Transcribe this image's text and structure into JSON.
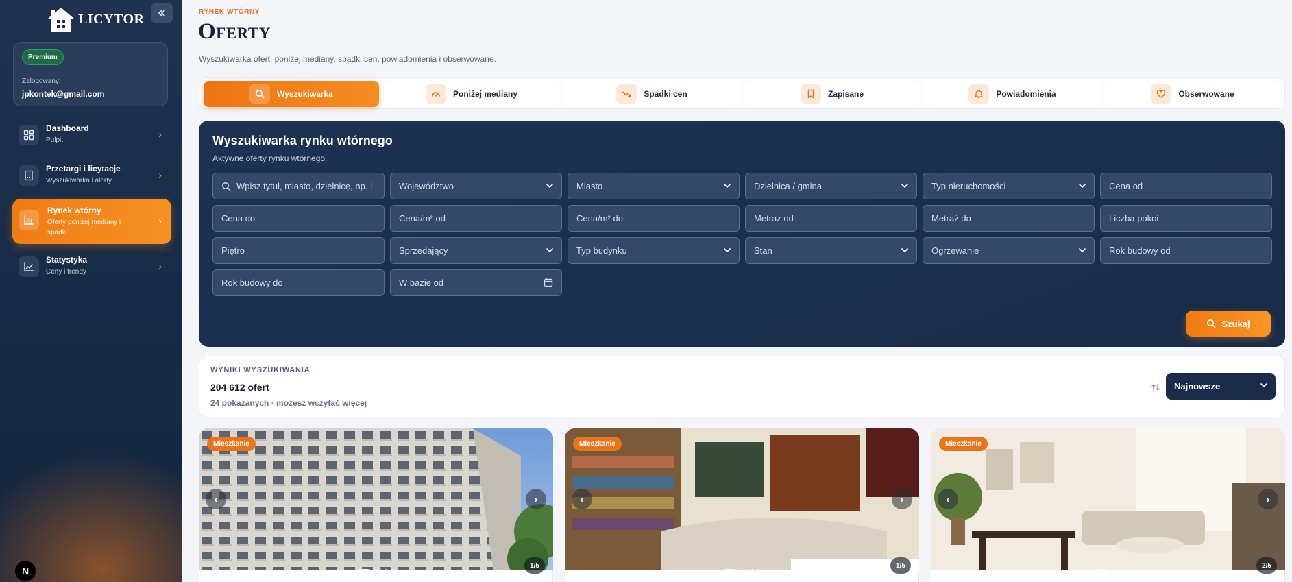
{
  "sidebar": {
    "logo": "LICYTOR",
    "collapse_icon": "double-chevron-left-icon",
    "user": {
      "badge": "Premium",
      "logged_label": "Zalogowany:",
      "email": "jpkontek@gmail.com"
    },
    "nav": [
      {
        "title": "Dashboard",
        "subtitle": "Pulpit",
        "icon": "dashboard-icon",
        "active": false
      },
      {
        "title": "Przetargi i licytacje",
        "subtitle": "Wyszukiwarka i alerty",
        "icon": "building-icon",
        "active": false
      },
      {
        "title": "Rynek wtórny",
        "subtitle": "Oferty poniżej mediany i spadki",
        "icon": "bar-chart-icon",
        "active": true
      },
      {
        "title": "Statystyka",
        "subtitle": "Ceny i trendy",
        "icon": "trend-chart-icon",
        "active": false
      }
    ],
    "footer_badge": "N"
  },
  "header": {
    "eyebrow": "RYNEK WTÓRNY",
    "title": "Oferty",
    "description": "Wyszukiwarka ofert, poniżej mediany, spadki cen, powiadomienia i obserwowane."
  },
  "tabs": [
    {
      "label": "Wyszukiwarka",
      "icon": "search-icon",
      "active": true
    },
    {
      "label": "Poniżej mediany",
      "icon": "gauge-icon",
      "active": false
    },
    {
      "label": "Spadki cen",
      "icon": "trending-down-icon",
      "active": false
    },
    {
      "label": "Zapisane",
      "icon": "bookmark-icon",
      "active": false
    },
    {
      "label": "Powiadomienia",
      "icon": "bell-icon",
      "active": false
    },
    {
      "label": "Obserwowane",
      "icon": "heart-icon",
      "active": false
    }
  ],
  "search": {
    "title": "Wyszukiwarka rynku wtórnego",
    "subtitle": "Aktywne oferty rynku wtórnego.",
    "query_placeholder": "Wpisz tytuł, miasto, dzielnicę, np. l",
    "fields": {
      "wojewodztwo": "Województwo",
      "miasto": "Miasto",
      "dzielnica": "Dzielnica / gmina",
      "typ_nieruchomosci": "Typ nieruchomości",
      "cena_od": "Cena od",
      "cena_do": "Cena do",
      "cena_m2_od": "Cena/m² od",
      "cena_m2_do": "Cena/m² do",
      "metraz_od": "Metraż od",
      "metraz_do": "Metraż do",
      "liczba_pokoi": "Liczba pokoi",
      "pietro": "Piętro",
      "sprzedajacy": "Sprzedający",
      "typ_budynku": "Typ budynku",
      "stan": "Stan",
      "ogrzewanie": "Ogrzewanie",
      "rok_budowy_od": "Rok budowy od",
      "rok_budowy_do": "Rok budowy do",
      "w_bazie_od": "W bazie od"
    },
    "button": "Szukaj"
  },
  "results": {
    "label": "WYNIKI WYSZUKIWANIA",
    "count": "204 612 ofert",
    "shown": "24 pokazanych · możesz wczytać więcej",
    "sort": "Najnowsze"
  },
  "listings": [
    {
      "type": "Mieszkanie",
      "counter": "1/5",
      "image": 1,
      "total": 5
    },
    {
      "type": "Mieszkanie",
      "counter": "1/5",
      "image": 1,
      "total": 5
    },
    {
      "type": "Mieszkanie",
      "counter": "2/5",
      "image": 2,
      "total": 5
    }
  ],
  "colors": {
    "accent": "#f07c14",
    "sidebar_bg": "#1b2e4a",
    "panel_bg": "#1d3253"
  }
}
